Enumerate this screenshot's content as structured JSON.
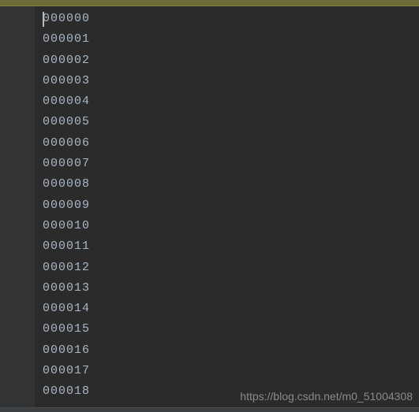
{
  "editor": {
    "lines": [
      "000000",
      "000001",
      "000002",
      "000003",
      "000004",
      "000005",
      "000006",
      "000007",
      "000008",
      "000009",
      "000010",
      "000011",
      "000012",
      "000013",
      "000014",
      "000015",
      "000016",
      "000017",
      "000018"
    ],
    "cursor_line": 0,
    "cursor_col": 0
  },
  "watermark": "https://blog.csdn.net/m0_51004308"
}
